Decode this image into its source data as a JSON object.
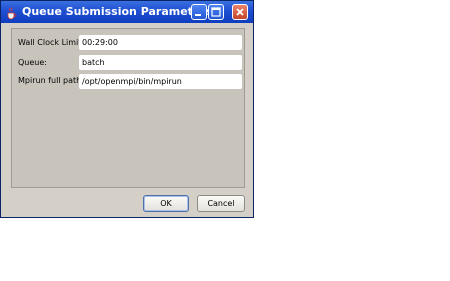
{
  "dialog": {
    "title": "Queue Submission Parameters"
  },
  "form": {
    "wall_clock_label": "Wall Clock Limit:",
    "wall_clock_value": "00:29:00",
    "queue_label": "Queue:",
    "queue_value": "batch",
    "mpirun_label": "Mpirun full path:",
    "mpirun_value": "/opt/openmpi/bin/mpirun"
  },
  "buttons": {
    "ok_label": "OK",
    "cancel_label": "Cancel"
  },
  "icons": {
    "app": "java-cup-icon",
    "minimize": "minimize-icon",
    "maximize": "maximize-icon",
    "close": "close-icon"
  },
  "colors": {
    "titlebar": "#1f4fd1",
    "dialog_bg": "#d4d0c8"
  }
}
